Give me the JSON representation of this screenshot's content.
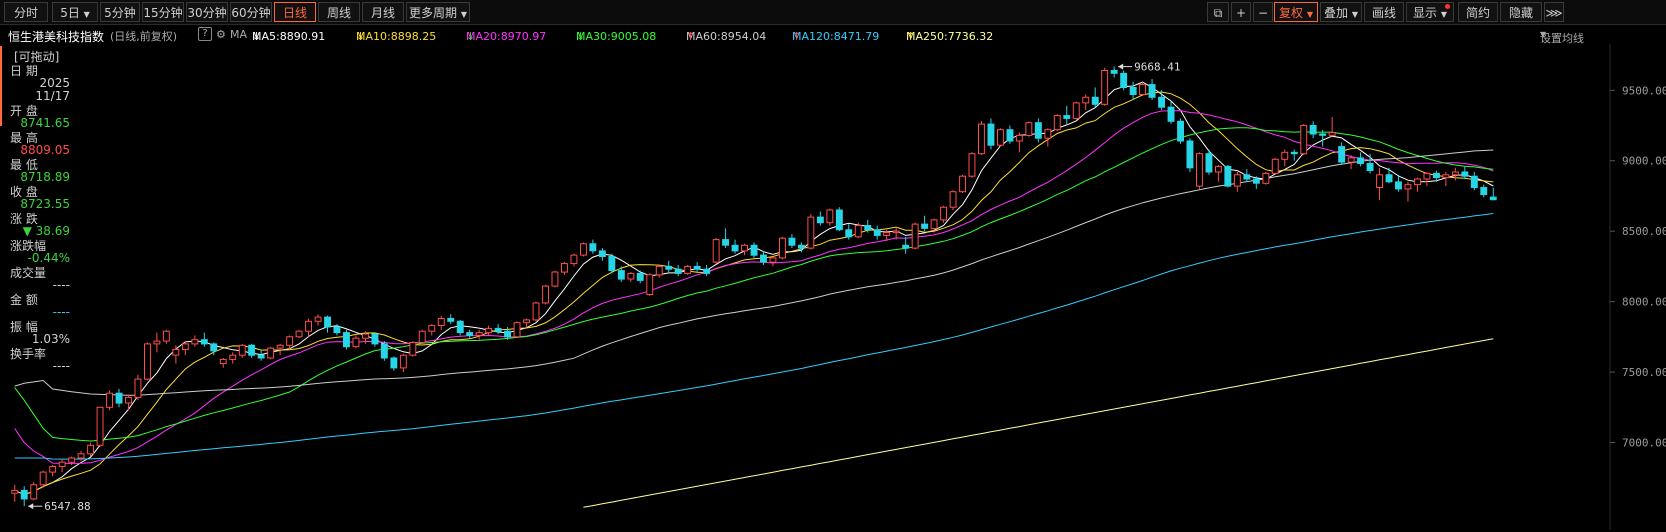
{
  "toolbar": {
    "left_buttons": [
      "分时",
      "5日",
      "5分钟",
      "15分钟",
      "30分钟",
      "60分钟",
      "日线",
      "周线",
      "月线",
      "更多周期"
    ],
    "active": "日线",
    "right_buttons": [
      "复权",
      "叠加",
      "画线",
      "显示",
      "简约",
      "隐藏"
    ]
  },
  "info": {
    "index_name": "恒生港美科技指数",
    "period_adj": "(日线,前复权)",
    "ma_label": "MA",
    "ma": [
      {
        "label": "MA5:8890.91",
        "color": "#ffffff",
        "arrow": "↓",
        "arrow_color": "#ffffff"
      },
      {
        "label": "MA10:8898.25",
        "color": "#ffdd33",
        "arrow": "↓",
        "arrow_color": "#ffdd33"
      },
      {
        "label": "MA20:8970.97",
        "color": "#ff33ff",
        "arrow": "↓",
        "arrow_color": "#3ed43e"
      },
      {
        "label": "MA30:9005.08",
        "color": "#33ff33",
        "arrow": "↓",
        "arrow_color": "#3ed43e"
      },
      {
        "label": "MA60:8954.04",
        "color": "#cccccc",
        "arrow": "↑",
        "arrow_color": "#ff4d4d"
      },
      {
        "label": "MA120:8471.79",
        "color": "#33ccff",
        "arrow": "↑",
        "arrow_color": "#ff4d4d"
      },
      {
        "label": "MA250:7736.32",
        "color": "#ffff99",
        "arrow": "↑",
        "arrow_color": "#ffdd33"
      }
    ],
    "settings": "设置均线"
  },
  "panel": {
    "drag": "[可拖动]",
    "date_label": "日 期",
    "year": "2025",
    "date": "11/17",
    "open_label": "开 盘",
    "open": "8741.65",
    "high_label": "最 高",
    "high": "8809.05",
    "low_label": "最 低",
    "low": "8718.89",
    "close_label": "收 盘",
    "close": "8723.55",
    "change_label": "涨 跌",
    "change": "▼ 38.69",
    "pct_label": "涨跌幅",
    "pct": "-0.44%",
    "volume_label": "成交量",
    "volume": "----",
    "amount_label": "金 额",
    "amount": "----",
    "amp_label": "振 幅",
    "amp": "1.03%",
    "turnover_label": "换手率",
    "turnover": "----"
  },
  "chart_data": {
    "type": "candlestick",
    "y_axis": {
      "ticks": [
        "9500.00",
        "9000.00",
        "8500.00",
        "8000.00",
        "7500.00",
        "7000.00"
      ],
      "min": 6450,
      "max": 9800
    },
    "annotations": {
      "max_label": "9668.41",
      "min_label": "6547.88"
    },
    "up_color": "#ff4d4d",
    "down_color": "#27d6e6",
    "candles": [
      [
        6640,
        6700,
        6580,
        6660
      ],
      [
        6660,
        6690,
        6548,
        6600
      ],
      [
        6600,
        6720,
        6590,
        6700
      ],
      [
        6700,
        6800,
        6680,
        6790
      ],
      [
        6790,
        6840,
        6760,
        6830
      ],
      [
        6830,
        6880,
        6790,
        6860
      ],
      [
        6860,
        6900,
        6840,
        6890
      ],
      [
        6890,
        6940,
        6870,
        6920
      ],
      [
        6920,
        7000,
        6900,
        6980
      ],
      [
        6980,
        7250,
        6970,
        7250
      ],
      [
        7250,
        7370,
        7230,
        7350
      ],
      [
        7350,
        7380,
        7250,
        7280
      ],
      [
        7280,
        7340,
        7230,
        7320
      ],
      [
        7320,
        7480,
        7300,
        7450
      ],
      [
        7450,
        7710,
        7440,
        7700
      ],
      [
        7700,
        7780,
        7640,
        7720
      ],
      [
        7720,
        7800,
        7700,
        7790
      ],
      [
        7620,
        7690,
        7560,
        7660
      ],
      [
        7660,
        7720,
        7620,
        7700
      ],
      [
        7700,
        7760,
        7680,
        7730
      ],
      [
        7730,
        7780,
        7680,
        7700
      ],
      [
        7700,
        7710,
        7620,
        7650
      ],
      [
        7560,
        7600,
        7530,
        7590
      ],
      [
        7590,
        7640,
        7560,
        7620
      ],
      [
        7620,
        7700,
        7600,
        7690
      ],
      [
        7690,
        7700,
        7600,
        7620
      ],
      [
        7620,
        7650,
        7580,
        7600
      ],
      [
        7600,
        7680,
        7590,
        7670
      ],
      [
        7670,
        7700,
        7620,
        7690
      ],
      [
        7690,
        7760,
        7660,
        7750
      ],
      [
        7750,
        7800,
        7740,
        7790
      ],
      [
        7790,
        7880,
        7750,
        7860
      ],
      [
        7860,
        7910,
        7830,
        7890
      ],
      [
        7890,
        7900,
        7780,
        7820
      ],
      [
        7820,
        7840,
        7760,
        7780
      ],
      [
        7780,
        7800,
        7660,
        7680
      ],
      [
        7680,
        7760,
        7670,
        7740
      ],
      [
        7740,
        7790,
        7700,
        7770
      ],
      [
        7770,
        7780,
        7680,
        7700
      ],
      [
        7700,
        7720,
        7580,
        7600
      ],
      [
        7600,
        7610,
        7510,
        7530
      ],
      [
        7530,
        7630,
        7500,
        7620
      ],
      [
        7620,
        7720,
        7610,
        7710
      ],
      [
        7710,
        7800,
        7700,
        7790
      ],
      [
        7790,
        7840,
        7760,
        7830
      ],
      [
        7830,
        7900,
        7800,
        7880
      ],
      [
        7880,
        7910,
        7840,
        7860
      ],
      [
        7860,
        7870,
        7760,
        7780
      ],
      [
        7780,
        7800,
        7740,
        7760
      ],
      [
        7760,
        7800,
        7730,
        7780
      ],
      [
        7780,
        7830,
        7760,
        7810
      ],
      [
        7810,
        7840,
        7770,
        7790
      ],
      [
        7790,
        7820,
        7730,
        7750
      ],
      [
        7750,
        7860,
        7740,
        7850
      ],
      [
        7850,
        7880,
        7820,
        7870
      ],
      [
        7870,
        8000,
        7860,
        7990
      ],
      [
        7990,
        8120,
        7980,
        8110
      ],
      [
        8110,
        8220,
        8100,
        8210
      ],
      [
        8210,
        8280,
        8190,
        8270
      ],
      [
        8270,
        8340,
        8250,
        8330
      ],
      [
        8330,
        8420,
        8320,
        8410
      ],
      [
        8410,
        8440,
        8340,
        8360
      ],
      [
        8360,
        8380,
        8290,
        8320
      ],
      [
        8320,
        8340,
        8200,
        8220
      ],
      [
        8220,
        8250,
        8140,
        8160
      ],
      [
        8160,
        8210,
        8140,
        8200
      ],
      [
        8200,
        8220,
        8130,
        8150
      ],
      [
        8050,
        8200,
        8040,
        8190
      ],
      [
        8190,
        8260,
        8170,
        8250
      ],
      [
        8250,
        8290,
        8210,
        8230
      ],
      [
        8230,
        8260,
        8180,
        8200
      ],
      [
        8200,
        8260,
        8190,
        8250
      ],
      [
        8250,
        8280,
        8210,
        8230
      ],
      [
        8230,
        8260,
        8180,
        8200
      ],
      [
        8280,
        8450,
        8270,
        8440
      ],
      [
        8440,
        8520,
        8380,
        8400
      ],
      [
        8400,
        8440,
        8340,
        8360
      ],
      [
        8360,
        8410,
        8330,
        8400
      ],
      [
        8400,
        8420,
        8310,
        8330
      ],
      [
        8330,
        8360,
        8260,
        8280
      ],
      [
        8280,
        8320,
        8250,
        8310
      ],
      [
        8310,
        8460,
        8300,
        8450
      ],
      [
        8450,
        8480,
        8380,
        8400
      ],
      [
        8400,
        8420,
        8350,
        8380
      ],
      [
        8380,
        8620,
        8370,
        8600
      ],
      [
        8600,
        8640,
        8540,
        8560
      ],
      [
        8560,
        8660,
        8540,
        8650
      ],
      [
        8650,
        8670,
        8500,
        8510
      ],
      [
        8510,
        8550,
        8440,
        8460
      ],
      [
        8460,
        8560,
        8450,
        8540
      ],
      [
        8540,
        8580,
        8490,
        8510
      ],
      [
        8510,
        8540,
        8440,
        8470
      ],
      [
        8470,
        8510,
        8430,
        8490
      ],
      [
        8490,
        8530,
        8440,
        8500
      ],
      [
        8400,
        8460,
        8340,
        8380
      ],
      [
        8380,
        8560,
        8370,
        8550
      ],
      [
        8550,
        8610,
        8500,
        8520
      ],
      [
        8520,
        8590,
        8490,
        8580
      ],
      [
        8580,
        8680,
        8560,
        8670
      ],
      [
        8670,
        8790,
        8650,
        8780
      ],
      [
        8780,
        8900,
        8770,
        8890
      ],
      [
        8890,
        9060,
        8880,
        9050
      ],
      [
        9050,
        9280,
        9040,
        9260
      ],
      [
        9260,
        9300,
        9080,
        9110
      ],
      [
        9110,
        9230,
        9100,
        9220
      ],
      [
        9220,
        9250,
        9120,
        9140
      ],
      [
        9140,
        9200,
        9060,
        9180
      ],
      [
        9180,
        9280,
        9170,
        9270
      ],
      [
        9270,
        9300,
        9130,
        9160
      ],
      [
        9160,
        9230,
        9100,
        9220
      ],
      [
        9220,
        9330,
        9210,
        9320
      ],
      [
        9320,
        9390,
        9260,
        9300
      ],
      [
        9300,
        9420,
        9290,
        9410
      ],
      [
        9410,
        9470,
        9360,
        9450
      ],
      [
        9450,
        9520,
        9380,
        9400
      ],
      [
        9400,
        9660,
        9390,
        9640
      ],
      [
        9640,
        9668,
        9590,
        9620
      ],
      [
        9620,
        9640,
        9500,
        9520
      ],
      [
        9520,
        9560,
        9430,
        9470
      ],
      [
        9470,
        9560,
        9460,
        9540
      ],
      [
        9540,
        9580,
        9430,
        9450
      ],
      [
        9450,
        9500,
        9360,
        9380
      ],
      [
        9380,
        9420,
        9260,
        9280
      ],
      [
        9280,
        9300,
        9120,
        9140
      ],
      [
        9140,
        9160,
        8920,
        8950
      ],
      [
        8820,
        9060,
        8800,
        9050
      ],
      [
        9050,
        9080,
        8900,
        8920
      ],
      [
        8920,
        8970,
        8850,
        8960
      ],
      [
        8960,
        8970,
        8810,
        8820
      ],
      [
        8820,
        8920,
        8780,
        8900
      ],
      [
        8900,
        8940,
        8850,
        8870
      ],
      [
        8870,
        8890,
        8800,
        8840
      ],
      [
        8840,
        8920,
        8830,
        8910
      ],
      [
        8910,
        9020,
        8900,
        9010
      ],
      [
        9010,
        9080,
        8960,
        9060
      ],
      [
        9060,
        9080,
        9000,
        9050
      ],
      [
        9050,
        9260,
        9040,
        9250
      ],
      [
        9250,
        9280,
        9160,
        9190
      ],
      [
        9190,
        9220,
        9100,
        9180
      ],
      [
        9180,
        9310,
        9170,
        9200
      ],
      [
        9100,
        9130,
        8970,
        8990
      ],
      [
        8990,
        9040,
        8940,
        9020
      ],
      [
        9020,
        9060,
        8960,
        8980
      ],
      [
        8980,
        9050,
        8910,
        8930
      ],
      [
        8810,
        8950,
        8720,
        8900
      ],
      [
        8900,
        8950,
        8840,
        8850
      ],
      [
        8850,
        8900,
        8780,
        8800
      ],
      [
        8800,
        8850,
        8710,
        8830
      ],
      [
        8830,
        8880,
        8780,
        8870
      ],
      [
        8870,
        8920,
        8820,
        8910
      ],
      [
        8910,
        8930,
        8850,
        8880
      ],
      [
        8880,
        8920,
        8820,
        8900
      ],
      [
        8900,
        8950,
        8860,
        8920
      ],
      [
        8920,
        8960,
        8870,
        8890
      ],
      [
        8890,
        8920,
        8790,
        8810
      ],
      [
        8810,
        8830,
        8740,
        8760
      ],
      [
        8741.65,
        8809.05,
        8718.89,
        8723.55
      ]
    ],
    "ma_colors": {
      "MA5": "#ffffff",
      "MA10": "#ffdd33",
      "MA20": "#ff33ff",
      "MA30": "#33ff33",
      "MA60": "#cccccc",
      "MA120": "#33ccff",
      "MA250": "#ffff99"
    },
    "ma_extensions": {
      "MA20": {
        "start": [
          7100,
          7000,
          6940,
          6900
        ]
      },
      "MA30": {
        "start": [
          7390,
          7300,
          7200,
          7100
        ]
      },
      "MA60": {
        "start": [
          7400,
          7420,
          7430,
          7440
        ]
      },
      "MA120": {
        "start": [
          6890,
          6890,
          6890,
          6890
        ]
      },
      "MA250": {
        "from_index": 60,
        "start_value": 6540,
        "end_value": 7736.32
      }
    }
  }
}
